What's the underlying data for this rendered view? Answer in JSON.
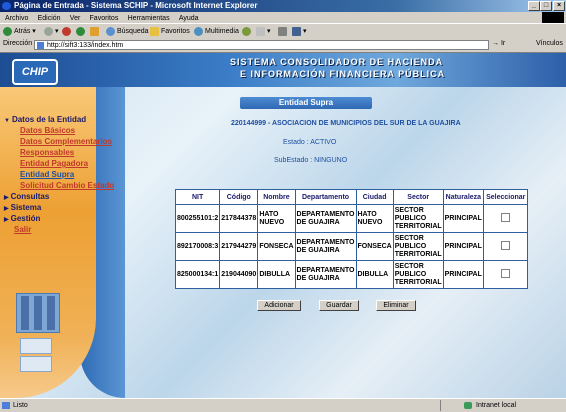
{
  "window": {
    "title": "Página de Entrada - Sistema SCHIP - Microsoft Internet Explorer"
  },
  "menu": [
    "Archivo",
    "Edición",
    "Ver",
    "Favoritos",
    "Herramientas",
    "Ayuda"
  ],
  "toolbar": {
    "back": "Atrás",
    "search": "Búsqueda",
    "favorites": "Favoritos",
    "multimedia": "Multimedia"
  },
  "address": {
    "label": "Dirección",
    "url": "http://sift3:133/index.htm",
    "go": "Ir",
    "links": "Vínculos"
  },
  "banner": {
    "line1": "SISTEMA CONSOLIDADOR DE HACIENDA",
    "line2": "E INFORMACIÓN FINANCIERA PÚBLICA",
    "logo": "CHIP"
  },
  "nav": {
    "datos": "Datos de la Entidad",
    "items": [
      "Datos Básicos",
      "Datos Complementarios",
      "Responsables",
      "Entidad Pagadora",
      "Entidad Supra",
      "Solicitud Cambio Estado"
    ],
    "consultas": "Consultas",
    "sistema": "Sistema",
    "gestion": "Gestión",
    "salir": "Salir"
  },
  "page": {
    "section_title": "Entidad Supra",
    "entity": "220144999 - ASOCIACION DE MUNICIPIOS DEL SUR DE LA GUAJIRA",
    "estado": "Estado : ACTIVO",
    "subestado": "SubEstado : NINGUNO"
  },
  "table": {
    "headers": [
      "NIT",
      "Código",
      "Nombre",
      "Departamento",
      "Ciudad",
      "Sector",
      "Naturaleza",
      "Seleccionar"
    ],
    "rows": [
      {
        "nit": "800255101:2",
        "codigo": "217844378",
        "nombre": "HATO NUEVO",
        "departamento": "DEPARTAMENTO DE GUAJIRA",
        "ciudad": "HATO NUEVO",
        "sector": "SECTOR PUBLICO TERRITORIAL",
        "naturaleza": "PRINCIPAL"
      },
      {
        "nit": "892170008:3",
        "codigo": "217944279",
        "nombre": "FONSECA",
        "departamento": "DEPARTAMENTO DE GUAJIRA",
        "ciudad": "FONSECA",
        "sector": "SECTOR PUBLICO TERRITORIAL",
        "naturaleza": "PRINCIPAL"
      },
      {
        "nit": "825000134:1",
        "codigo": "219044090",
        "nombre": "DIBULLA",
        "departamento": "DEPARTAMENTO DE GUAJIRA",
        "ciudad": "DIBULLA",
        "sector": "SECTOR PUBLICO TERRITORIAL",
        "naturaleza": "PRINCIPAL"
      }
    ]
  },
  "buttons": {
    "add": "Adicionar",
    "save": "Guardar",
    "delete": "Eliminar"
  },
  "status": {
    "text": "Listo",
    "zone": "Intranet local"
  }
}
